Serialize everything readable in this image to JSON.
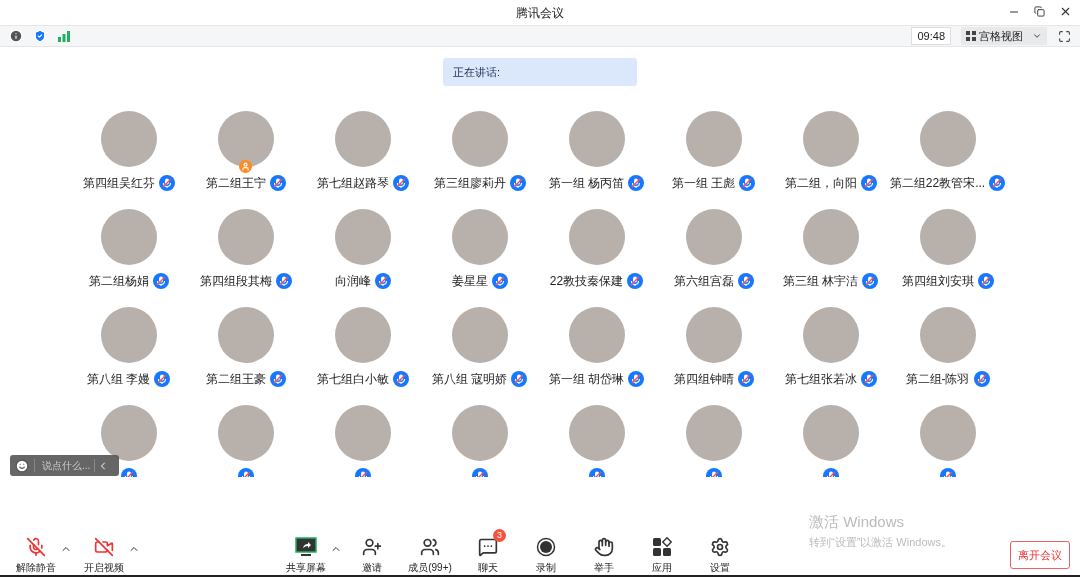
{
  "window": {
    "title": "腾讯会议"
  },
  "toolbar": {
    "time": "09:48",
    "view": "宫格视图"
  },
  "speaking": {
    "label": "正在讲话:"
  },
  "participants": [
    {
      "name": "第四组吴红芬",
      "muted": true,
      "host": false
    },
    {
      "name": "第二组王宁",
      "muted": true,
      "host": true
    },
    {
      "name": "第七组赵路琴",
      "muted": true,
      "host": false
    },
    {
      "name": "第三组廖莉丹",
      "muted": true,
      "host": false
    },
    {
      "name": "第一组  杨丙笛",
      "muted": true,
      "host": false
    },
    {
      "name": "第一组 王彪",
      "muted": true,
      "host": false
    },
    {
      "name": "第二组，向阳",
      "muted": true,
      "host": false
    },
    {
      "name": "第二组22教管宋...",
      "muted": true,
      "host": false
    },
    {
      "name": "第二组杨娟",
      "muted": true,
      "host": false
    },
    {
      "name": "第四组段其梅",
      "muted": true,
      "host": false
    },
    {
      "name": "向润峰",
      "muted": true,
      "host": false
    },
    {
      "name": "姜星星",
      "muted": true,
      "host": false
    },
    {
      "name": "22教技秦保建",
      "muted": true,
      "host": false
    },
    {
      "name": "第六组宫磊",
      "muted": true,
      "host": false
    },
    {
      "name": "第三组 林宇洁",
      "muted": true,
      "host": false
    },
    {
      "name": "第四组刘安琪",
      "muted": true,
      "host": false
    },
    {
      "name": "第八组   李嫚",
      "muted": true,
      "host": false
    },
    {
      "name": "第二组王豪",
      "muted": true,
      "host": false
    },
    {
      "name": "第七组白小敏",
      "muted": true,
      "host": false
    },
    {
      "name": "第八组    寇明娇",
      "muted": true,
      "host": false
    },
    {
      "name": "第一组 胡岱琳",
      "muted": true,
      "host": false
    },
    {
      "name": "第四组钟晴",
      "muted": true,
      "host": false
    },
    {
      "name": "第七组张若冰",
      "muted": true,
      "host": false
    },
    {
      "name": "第二组-陈羽",
      "muted": true,
      "host": false
    },
    {
      "muted": true,
      "host": false
    },
    {
      "muted": true,
      "host": false
    },
    {
      "muted": true,
      "host": false
    },
    {
      "muted": true,
      "host": false
    },
    {
      "muted": true,
      "host": false
    },
    {
      "muted": true,
      "host": false
    },
    {
      "muted": true,
      "host": false
    },
    {
      "muted": true,
      "host": false
    }
  ],
  "chat_input": {
    "placeholder": "说点什么..."
  },
  "controls_left": [
    {
      "kind": "mic",
      "label": "解除静音",
      "off": true,
      "menu": true
    },
    {
      "kind": "video",
      "label": "开启视频",
      "off": true,
      "menu": true
    }
  ],
  "controls_center": [
    {
      "kind": "share",
      "label": "共享屏幕",
      "menu": true
    },
    {
      "kind": "invite",
      "label": "邀请",
      "menu": false
    },
    {
      "kind": "members",
      "label": "成员(99+)",
      "menu": false
    },
    {
      "kind": "chat",
      "label": "聊天",
      "menu": false,
      "badge": "3"
    },
    {
      "kind": "record",
      "label": "录制",
      "menu": false
    },
    {
      "kind": "hand",
      "label": "举手",
      "menu": false
    },
    {
      "kind": "apps",
      "label": "应用",
      "menu": false
    },
    {
      "kind": "settings",
      "label": "设置",
      "menu": false
    }
  ],
  "leave_button": "离开会议",
  "os_notice": {
    "title": "激活 Windows",
    "text": "转到“设置”以激活 Windows。"
  }
}
